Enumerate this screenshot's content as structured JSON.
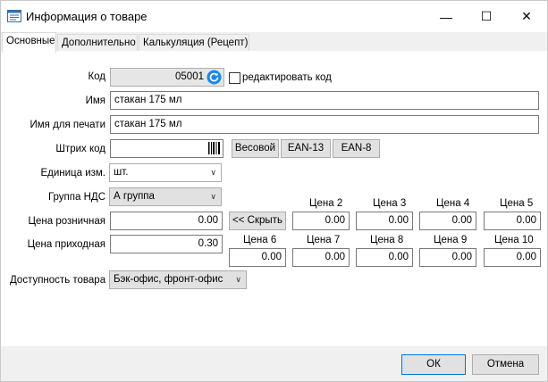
{
  "window": {
    "title": "Информация о товаре",
    "minimize": "—",
    "maximize": "☐",
    "close": "✕"
  },
  "tabs": [
    "Основные",
    "Дополнительно",
    "Калькуляция (Рецепт)"
  ],
  "form": {
    "code_label": "Код",
    "code_value": "05001",
    "edit_code_label": "редактировать код",
    "name_label": "Имя",
    "name_value": "стакан 175 мл",
    "print_name_label": "Имя для печати",
    "print_name_value": "стакан 175 мл",
    "barcode_label": "Штрих код",
    "barcode_value": "",
    "weight_button": "Весовой",
    "ean13_button": "EAN-13",
    "ean8_button": "EAN-8",
    "unit_label": "Единица изм.",
    "unit_value": "шт.",
    "vat_label": "Группа НДС",
    "vat_value": "А группа",
    "retail_label": "Цена розничная",
    "retail_value": "0.00",
    "hide_button": "<< Скрыть",
    "purchase_label": "Цена приходная",
    "purchase_value": "0.30",
    "availability_label": "Доступность товара",
    "availability_value": "Бэк-офис, фронт-офис"
  },
  "prices": [
    {
      "label": "Цена 2",
      "value": "0.00"
    },
    {
      "label": "Цена 3",
      "value": "0.00"
    },
    {
      "label": "Цена 4",
      "value": "0.00"
    },
    {
      "label": "Цена 5",
      "value": "0.00"
    },
    {
      "label": "Цена 6",
      "value": "0.00"
    },
    {
      "label": "Цена 7",
      "value": "0.00"
    },
    {
      "label": "Цена 8",
      "value": "0.00"
    },
    {
      "label": "Цена 9",
      "value": "0.00"
    },
    {
      "label": "Цена 10",
      "value": "0.00"
    }
  ],
  "footer": {
    "ok": "ОК",
    "cancel": "Отмена"
  },
  "colors": {
    "accent": "#0078d7",
    "refresh_icon": "#1e88e5"
  }
}
